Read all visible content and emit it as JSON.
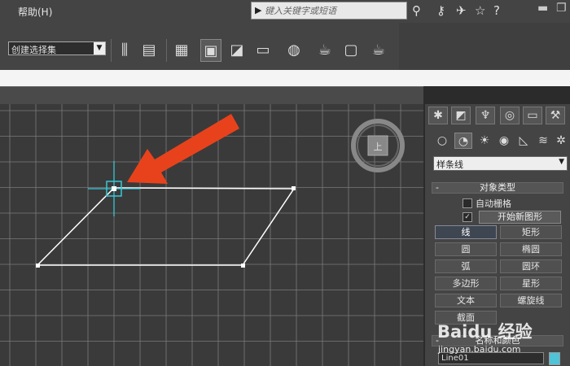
{
  "menu": {
    "help_label": "帮助(H)"
  },
  "search": {
    "placeholder": "键入关键字或短语"
  },
  "toolbar": {
    "selection_set_value": "创建选择集"
  },
  "command_panel": {
    "category_value": "样条线",
    "object_type_rollout": "对象类型",
    "auto_grid_label": "自动栅格",
    "start_new_shape_label": "开始新图形",
    "start_new_shape_checked": true,
    "buttons": [
      "线",
      "矩形",
      "圆",
      "椭圆",
      "弧",
      "圆环",
      "多边形",
      "星形",
      "文本",
      "螺旋线",
      "截面"
    ],
    "active_button": "线",
    "name_color_rollout": "名称和颜色",
    "object_name": "Line01",
    "object_color": "#4fc3d8"
  },
  "watermark": {
    "brand": "Baidu 经验",
    "url": "jingyan.baidu.com"
  },
  "colors": {
    "grid_background": "#3a3a3a",
    "grid_line": "#7a7a7a",
    "spline": "#ffffff",
    "cursor": "#39c7d6",
    "arrow": "#e8421c"
  }
}
